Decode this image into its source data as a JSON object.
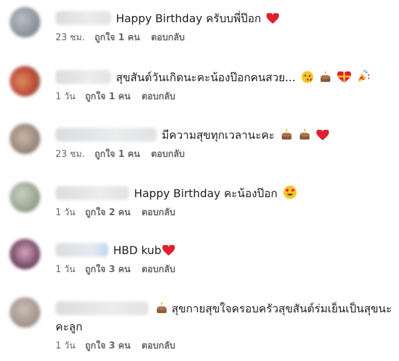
{
  "comments": [
    {
      "avatar_color": "#8a8f9a",
      "text": "Happy Birthday ครับบพี่ป๊อก",
      "emojis": [
        "heart"
      ],
      "age": "23 ชม.",
      "likes": "ถูกใจ 1 คน",
      "reply": "ตอบกลับ"
    },
    {
      "avatar_color": "#d06a4a",
      "text": "สุขสันต์วันเกิดนะคะน้องป๊อกคนสวย...",
      "emojis": [
        "kiss-face",
        "cake",
        "gift-heart",
        "party-popper"
      ],
      "age": "1 วัน",
      "likes": "ถูกใจ 1 คน",
      "reply": "ตอบกลับ"
    },
    {
      "avatar_color": "#9c8a7c",
      "text": "มีความสุขทุกเวลานะคะ",
      "emojis": [
        "cake",
        "cake",
        "heart"
      ],
      "age": "23 ชม.",
      "likes": "ถูกใจ 1 คน",
      "reply": "ตอบกลับ"
    },
    {
      "avatar_color": "#8fa08a",
      "text": "Happy Birthday คะน้องป๊อก",
      "emojis": [
        "heart-eyes-face"
      ],
      "age": "1 วัน",
      "likes": "ถูกใจ 2 คน",
      "reply": "ตอบกลับ"
    },
    {
      "avatar_color": "#7a4f6b",
      "text": "HBD kub",
      "emojis": [
        "heart"
      ],
      "age": "1 วัน",
      "likes": "ถูกใจ 3 คน",
      "reply": "ตอบกลับ"
    },
    {
      "avatar_color": "#9a8c82",
      "text": "สุขกายสุขใจครอบครัวสุขสันต์ร่มเย็นเป็นสุขนะคะลูก",
      "emojis_before": [
        "cake"
      ],
      "age": "1 วัน",
      "likes": "ถูกใจ 3 คน",
      "reply": "ตอบกลับ"
    }
  ],
  "colors": {
    "heart": "#e0202e",
    "cake": "#8a5a3a",
    "meta_text": "#65676b"
  }
}
